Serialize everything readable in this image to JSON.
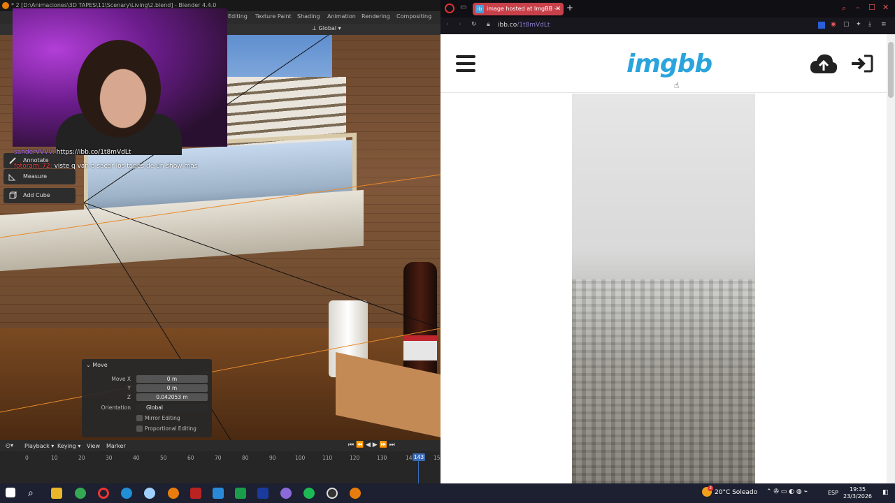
{
  "blender": {
    "title": "* 2 [D:\\Animaciones\\3D TAPES\\11\\Scenary\\Living\\2.blend] - Blender 4.4.0",
    "workspaces": [
      "Editing",
      "Texture Paint",
      "Shading",
      "Animation",
      "Rendering",
      "Compositing"
    ],
    "orientation_header": "Global",
    "tools": [
      "Annotate",
      "Measure",
      "Add Cube"
    ],
    "chat": [
      {
        "user": "sanderVVVV:",
        "msg": "https://ibb.co/1t8mVdLt"
      },
      {
        "user": "fotoram_72:",
        "msg": "viste q van a sacar los tapes de un show mas"
      }
    ],
    "move_panel": {
      "title": "Move",
      "move_x_label": "Move X",
      "move_x": "0 m",
      "y_label": "Y",
      "y": "0 m",
      "z_label": "Z",
      "z": "0.042053 m",
      "orientation_label": "Orientation",
      "orientation": "Global",
      "mirror": "Mirror Editing",
      "proportional": "Proportional Editing"
    },
    "timeline": {
      "menus": [
        "Playback",
        "Keying",
        "View",
        "Marker"
      ],
      "ticks": [
        "0",
        "10",
        "20",
        "30",
        "40",
        "50",
        "60",
        "70",
        "80",
        "90",
        "100",
        "110",
        "120",
        "130",
        "14",
        "15"
      ],
      "current_frame": "143"
    }
  },
  "browser": {
    "tab_title": "image hosted at ImgBB —",
    "tab_icon": "ib",
    "url_host": "ibb.co",
    "url_path": "/1t8mVdLt",
    "site_logo": "imgbb"
  },
  "taskbar": {
    "weather": "20°C  Soleado",
    "lang": "ESP",
    "time": "19:35",
    "date": "23/3/2026",
    "badge": "3"
  },
  "colors": {
    "blender_accent": "#e87d0d",
    "imgbb_blue": "#2aa4dd",
    "tab_red": "#c8404a",
    "timeline_blue": "#3a6bb5"
  }
}
